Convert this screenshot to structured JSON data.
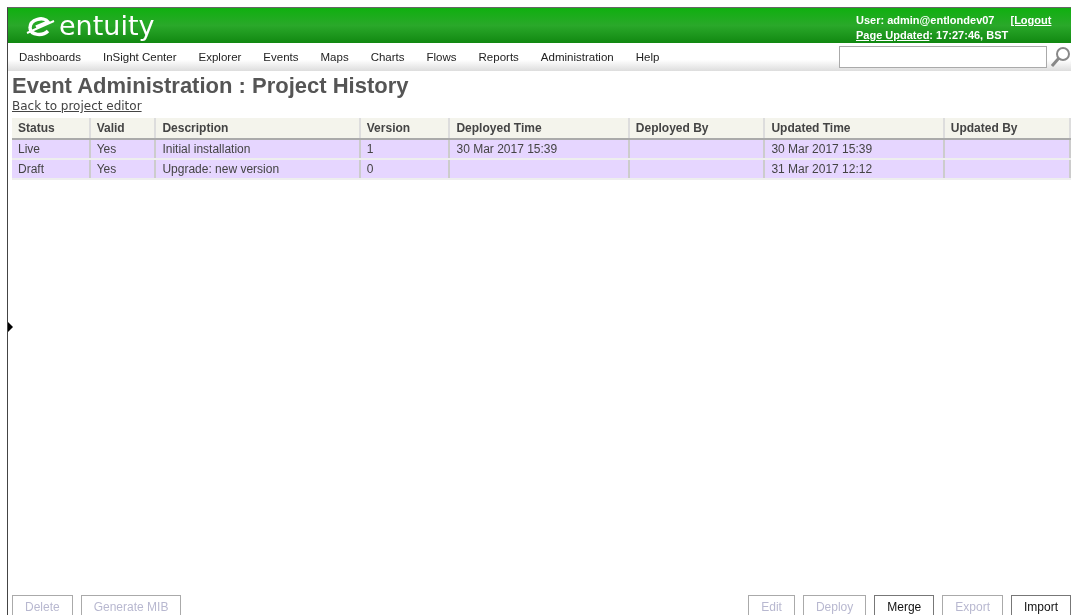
{
  "header": {
    "logo": "entuity",
    "user": "User: admin@entlondev07",
    "logout": "[Logout",
    "page_updated_label": "Page Updated",
    "page_updated_value": ": 17:27:46, BST"
  },
  "nav": [
    "Dashboards",
    "InSight Center",
    "Explorer",
    "Events",
    "Maps",
    "Charts",
    "Flows",
    "Reports",
    "Administration",
    "Help"
  ],
  "page_title": "Event Administration : Project History",
  "back_link": "Back to project editor",
  "table": {
    "columns": [
      "Status",
      "Valid",
      "Description",
      "Version",
      "Deployed Time",
      "Deployed By",
      "Updated Time",
      "Updated By"
    ],
    "rows": [
      {
        "cells": [
          "Live",
          "Yes",
          "Initial installation",
          "1",
          "30 Mar 2017 15:39",
          "",
          "30 Mar 2017 15:39",
          ""
        ]
      },
      {
        "cells": [
          "Draft",
          "Yes",
          "Upgrade: new version",
          "0",
          "",
          "",
          "31 Mar 2017 12:12",
          ""
        ]
      }
    ]
  },
  "left_buttons": [
    {
      "label": "Delete",
      "disabled": true
    },
    {
      "label": "Generate MIB",
      "disabled": true
    }
  ],
  "right_buttons": [
    {
      "label": "Edit",
      "disabled": true
    },
    {
      "label": "Deploy",
      "disabled": true
    },
    {
      "label": "Merge",
      "disabled": false
    },
    {
      "label": "Export",
      "disabled": true
    },
    {
      "label": "Import",
      "disabled": false
    }
  ]
}
